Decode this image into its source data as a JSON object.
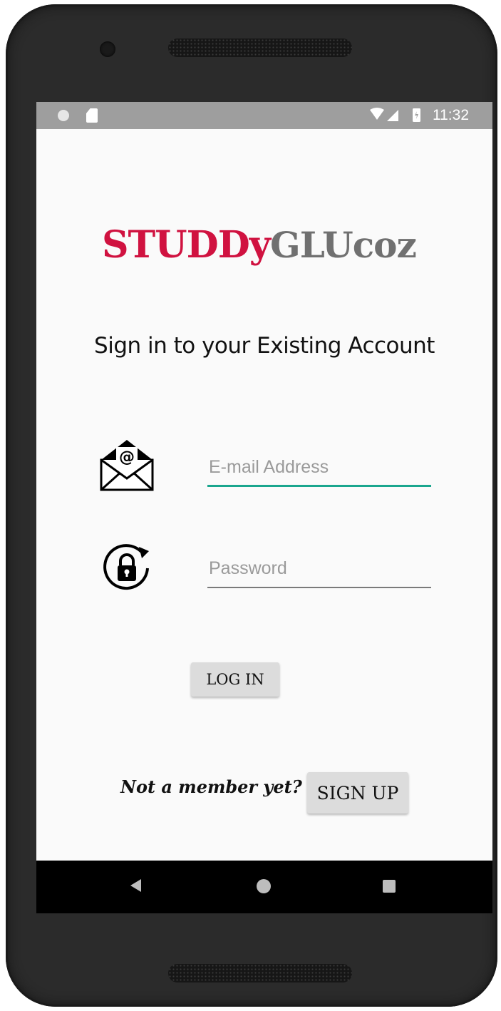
{
  "status_bar": {
    "time": "11:32",
    "icons": [
      "notification-dot-icon",
      "sd-card-icon",
      "wifi-icon",
      "signal-icon",
      "battery-icon"
    ]
  },
  "app": {
    "logo_part1": "STUDDy",
    "logo_part2": "GLUcoz",
    "brand_color": "#d01240",
    "logo_gray": "#707070",
    "subtitle": "Sign in to your Existing Account"
  },
  "form": {
    "email_placeholder": "E-mail Address",
    "email_value": "",
    "password_placeholder": "Password",
    "password_value": "",
    "login_label": "LOG IN",
    "focus_color": "#1aa68e"
  },
  "footer": {
    "member_text": "Not a member yet?",
    "signup_label": "SIGN UP"
  },
  "nav": {
    "icons": [
      "back-icon",
      "home-icon",
      "recents-icon"
    ]
  }
}
